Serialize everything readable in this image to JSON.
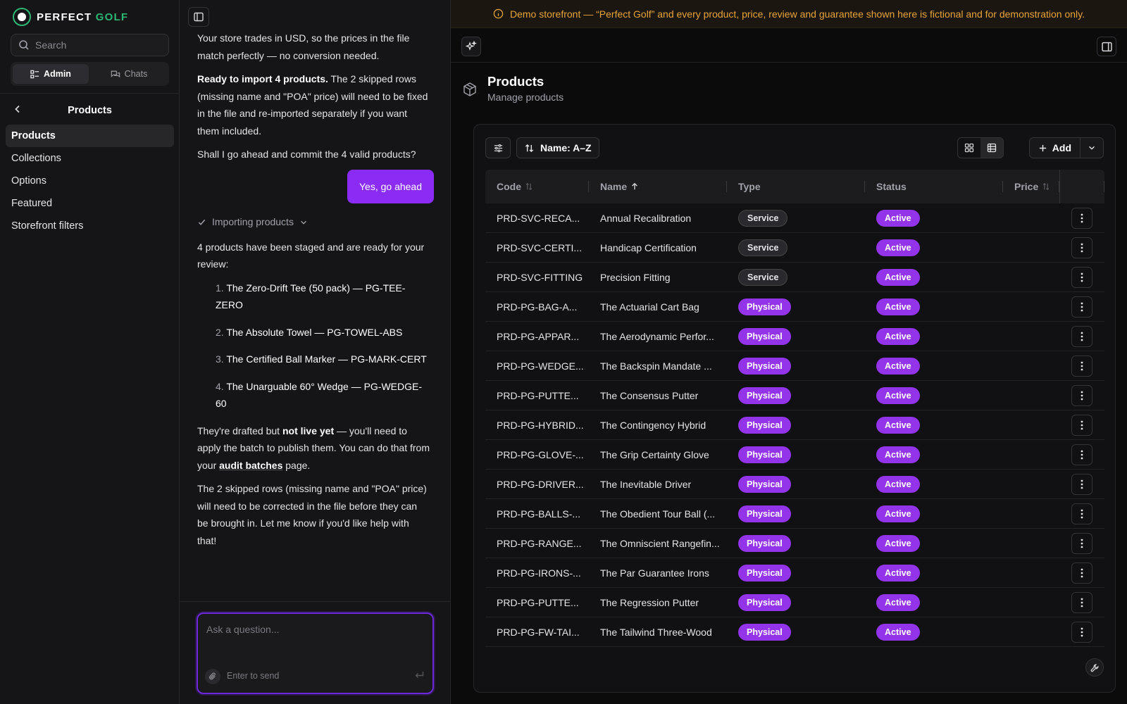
{
  "brand": {
    "name_a": "PERFECT",
    "name_b": "GOLF"
  },
  "sidebar": {
    "search_placeholder": "Search",
    "tabs": [
      {
        "label": "Admin"
      },
      {
        "label": "Chats"
      }
    ],
    "section_title": "Products",
    "items": [
      {
        "label": "Products"
      },
      {
        "label": "Collections"
      },
      {
        "label": "Options"
      },
      {
        "label": "Featured"
      },
      {
        "label": "Storefront filters"
      }
    ]
  },
  "chat": {
    "p1": "Your store trades in USD, so the prices in the file match perfectly — no conversion needed.",
    "p2_bold": "Ready to import 4 products.",
    "p2_rest": " The 2 skipped rows (missing name and \"POA\" price) will need to be fixed in the file and re-imported separately if you want them included.",
    "p3": "Shall I go ahead and commit the 4 valid products?",
    "user_message": "Yes, go ahead",
    "tool_label": "Importing products",
    "p4": "4 products have been staged and are ready for your review:",
    "list": [
      {
        "n": "1.",
        "text": "The Zero-Drift Tee (50 pack) — PG-TEE-ZERO"
      },
      {
        "n": "2.",
        "text": "The Absolute Towel — PG-TOWEL-ABS"
      },
      {
        "n": "3.",
        "text": "The Certified Ball Marker — PG-MARK-CERT"
      },
      {
        "n": "4.",
        "text": "The Unarguable 60° Wedge — PG-WEDGE-60"
      }
    ],
    "p5_a": "They're drafted but ",
    "p5_bold": "not live yet",
    "p5_b": " — you'll need to apply the batch to publish them. You can do that from your ",
    "p5_link": "audit batches",
    "p5_c": " page.",
    "p6": "The 2 skipped rows (missing name and \"POA\" price) will need to be corrected in the file before they can be brought in. Let me know if you'd like help with that!",
    "composer_placeholder": "Ask a question...",
    "composer_hint": "Enter to send"
  },
  "banner": {
    "text": "Demo storefront — “Perfect Golf” and every product, price, review and guarantee shown here is fictional and for demonstration only."
  },
  "page": {
    "title": "Products",
    "subtitle": "Manage products"
  },
  "toolbar": {
    "sort_label": "Name: A–Z",
    "add_label": "Add"
  },
  "table": {
    "columns": [
      {
        "label": "Code"
      },
      {
        "label": "Name"
      },
      {
        "label": "Type"
      },
      {
        "label": "Status"
      },
      {
        "label": "Price"
      }
    ],
    "rows": [
      {
        "code": "PRD-SVC-RECA...",
        "name": "Annual Recalibration",
        "type": "Service",
        "status": "Active"
      },
      {
        "code": "PRD-SVC-CERTI...",
        "name": "Handicap Certification",
        "type": "Service",
        "status": "Active"
      },
      {
        "code": "PRD-SVC-FITTING",
        "name": "Precision Fitting",
        "type": "Service",
        "status": "Active"
      },
      {
        "code": "PRD-PG-BAG-A...",
        "name": "The Actuarial Cart Bag",
        "type": "Physical",
        "status": "Active"
      },
      {
        "code": "PRD-PG-APPAR...",
        "name": "The Aerodynamic Perfor...",
        "type": "Physical",
        "status": "Active"
      },
      {
        "code": "PRD-PG-WEDGE...",
        "name": "The Backspin Mandate ...",
        "type": "Physical",
        "status": "Active"
      },
      {
        "code": "PRD-PG-PUTTE...",
        "name": "The Consensus Putter",
        "type": "Physical",
        "status": "Active"
      },
      {
        "code": "PRD-PG-HYBRID...",
        "name": "The Contingency Hybrid",
        "type": "Physical",
        "status": "Active"
      },
      {
        "code": "PRD-PG-GLOVE-...",
        "name": "The Grip Certainty Glove",
        "type": "Physical",
        "status": "Active"
      },
      {
        "code": "PRD-PG-DRIVER...",
        "name": "The Inevitable Driver",
        "type": "Physical",
        "status": "Active"
      },
      {
        "code": "PRD-PG-BALLS-...",
        "name": "The Obedient Tour Ball (...",
        "type": "Physical",
        "status": "Active"
      },
      {
        "code": "PRD-PG-RANGE...",
        "name": "The Omniscient Rangefin...",
        "type": "Physical",
        "status": "Active"
      },
      {
        "code": "PRD-PG-IRONS-...",
        "name": "The Par Guarantee Irons",
        "type": "Physical",
        "status": "Active"
      },
      {
        "code": "PRD-PG-PUTTE...",
        "name": "The Regression Putter",
        "type": "Physical",
        "status": "Active"
      },
      {
        "code": "PRD-PG-FW-TAI...",
        "name": "The Tailwind Three-Wood",
        "type": "Physical",
        "status": "Active"
      }
    ]
  },
  "colors": {
    "accent": "#9333ea",
    "brand_green": "#2bb673",
    "banner_text": "#e8a33b"
  }
}
